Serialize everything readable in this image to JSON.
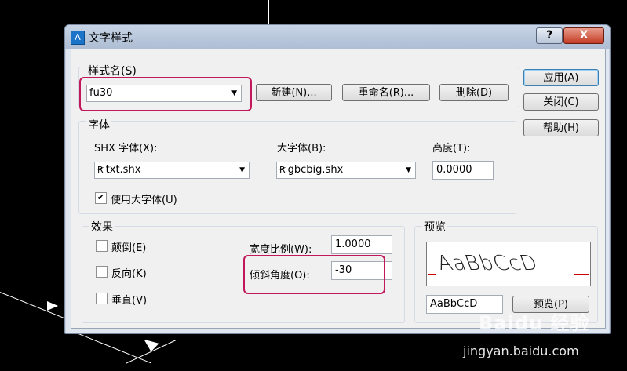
{
  "window": {
    "title": "文字样式",
    "title_icon": "A",
    "help_label": "?",
    "close_label": "X"
  },
  "style_name": {
    "group_label": "样式名(S)",
    "selected": "fu30",
    "new_label": "新建(N)...",
    "rename_label": "重命名(R)...",
    "delete_label": "删除(D)"
  },
  "font": {
    "group_label": "字体",
    "shx_label": "SHX 字体(X):",
    "shx_value": "txt.shx",
    "bigfont_label": "大字体(B):",
    "bigfont_value": "gbcbig.shx",
    "height_label": "高度(T):",
    "height_value": "0.0000",
    "use_bigfont_label": "使用大字体(U)",
    "use_bigfont_checked": true
  },
  "effects": {
    "group_label": "效果",
    "upside_down_label": "颠倒(E)",
    "backwards_label": "反向(K)",
    "vertical_label": "垂直(V)",
    "width_factor_label": "宽度比例(W):",
    "width_factor_value": "1.0000",
    "oblique_label": "倾斜角度(O):",
    "oblique_value": "-30"
  },
  "preview": {
    "group_label": "预览",
    "sample_text": "AaBbCcD",
    "input_value": "AaBbCcD",
    "preview_button_label": "预览(P)"
  },
  "side_buttons": {
    "apply_label": "应用(A)",
    "close_label": "关闭(C)",
    "help_label": "帮助(H)"
  },
  "watermark": {
    "logo_text": "Baidu 经验",
    "url_text": "jingyan.baidu.com"
  },
  "colors": {
    "highlight": "#c2185b",
    "titlebar": "#aebdd3",
    "close_button": "#c33b25"
  },
  "icons": [
    "dropdown-arrow-icon",
    "shx-font-icon",
    "checkmark-icon"
  ]
}
